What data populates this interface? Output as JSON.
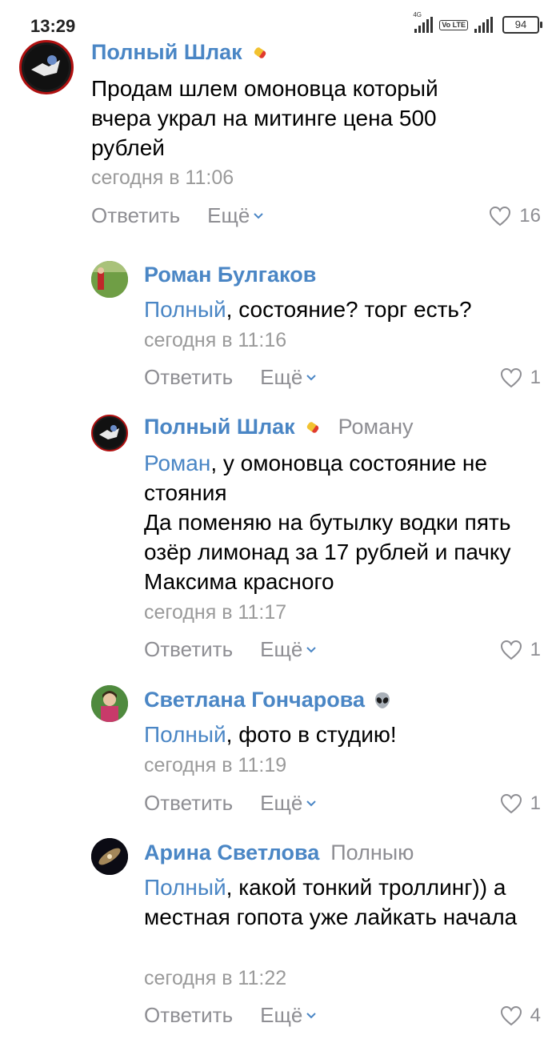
{
  "status": {
    "time": "13:29",
    "net1": "4G",
    "volte": "Vo LTE",
    "battery": "94"
  },
  "comments": [
    {
      "author": "Полный Шлак",
      "author_emoji": "pill-emoji",
      "text": "Продам шлем омоновца который вчера украл на митинге цена 500 рублей",
      "time": "сегодня в 11:06",
      "reply_label": "Ответить",
      "more_label": "Ещё",
      "likes": "16"
    },
    {
      "author": "Роман Булгаков",
      "mention": "Полный",
      "text": ", состояние? торг есть?",
      "time": "сегодня в 11:16",
      "reply_label": "Ответить",
      "more_label": "Ещё",
      "likes": "1"
    },
    {
      "author": "Полный Шлак",
      "author_emoji": "pill-emoji",
      "reply_to": "Роману",
      "mention": "Роман",
      "text": ", у омоновца состояние не стояния",
      "text2": "Да поменяю на бутылку водки пять озёр лимонад за 17 рублей и пачку Максима красного",
      "time": "сегодня в 11:17",
      "reply_label": "Ответить",
      "more_label": "Ещё",
      "likes": "1"
    },
    {
      "author": "Светлана Гончарова",
      "author_emoji": "alien-emoji",
      "mention": "Полный",
      "text": ", фото в студию!",
      "time": "сегодня в 11:19",
      "reply_label": "Ответить",
      "more_label": "Ещё",
      "likes": "1"
    },
    {
      "author": "Арина Светлова",
      "reply_to": "Полныю",
      "mention": "Полный",
      "text": ", какой тонкий троллинг)) а местная гопота уже лайкать начала",
      "time": "сегодня в 11:22",
      "reply_label": "Ответить",
      "more_label": "Ещё",
      "likes": "4"
    }
  ],
  "colors": {
    "link": "#4a86c5",
    "meta": "#8e8e93",
    "time": "#9a9a9a"
  }
}
